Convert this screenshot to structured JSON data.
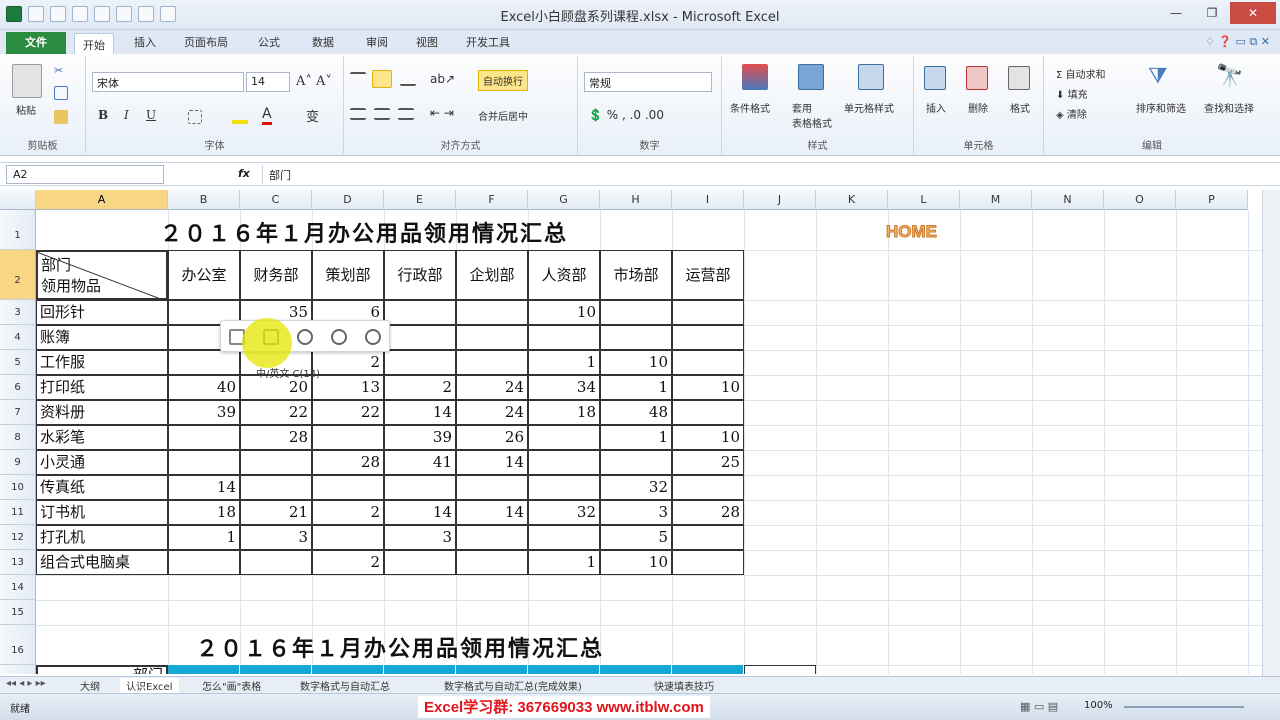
{
  "window": {
    "title": "Excel小白顾盘系列课程.xlsx - Microsoft Excel"
  },
  "tabs": {
    "file": "文件",
    "items": [
      "开始",
      "插入",
      "页面布局",
      "公式",
      "数据",
      "审阅",
      "视图",
      "开发工具"
    ]
  },
  "ribbon": {
    "font_name": "宋体",
    "font_size": "14",
    "number_format": "常规",
    "wrap_text": "自动换行",
    "merge_center": "合并后居中",
    "groups": {
      "clipboard": "剪贴板",
      "font": "字体",
      "align": "对齐方式",
      "number": "数字",
      "styles": "样式",
      "cells": "单元格",
      "edit": "编辑"
    },
    "buttons": {
      "paste": "粘贴",
      "cond": "条件格式",
      "table": "套用\n表格格式",
      "cellstyle": "单元格样式",
      "insert": "插入",
      "delete": "删除",
      "format": "格式",
      "autosum": "自动求和",
      "fill": "填充",
      "clear": "清除",
      "sort": "排序和筛选",
      "find": "查找和选择"
    }
  },
  "formula_bar": {
    "name_box": "A2",
    "fx": "fx",
    "content": "部门"
  },
  "columns": [
    "A",
    "B",
    "C",
    "D",
    "E",
    "F",
    "G",
    "H",
    "I",
    "J",
    "K",
    "L",
    "M",
    "N",
    "O",
    "P"
  ],
  "rows": [
    "1",
    "2",
    "3",
    "4",
    "5",
    "6",
    "7",
    "8",
    "9",
    "10",
    "11",
    "12",
    "13",
    "14",
    "15",
    "16",
    "17"
  ],
  "table1": {
    "title": "２０１６年１月办公用品领用情况汇总",
    "corner_top": "部门",
    "corner_bottom": "领用物品",
    "headers": [
      "办公室",
      "财务部",
      "策划部",
      "行政部",
      "企划部",
      "人资部",
      "市场部",
      "运营部"
    ],
    "rows": [
      {
        "item": "回形针",
        "vals": [
          "",
          "35",
          "6",
          "",
          "",
          "10",
          "",
          ""
        ]
      },
      {
        "item": "账簿",
        "vals": [
          "",
          "",
          "",
          "",
          "",
          "",
          "",
          ""
        ]
      },
      {
        "item": "工作服",
        "vals": [
          "",
          "",
          "2",
          "",
          "",
          "1",
          "10",
          ""
        ]
      },
      {
        "item": "打印纸",
        "vals": [
          "40",
          "20",
          "13",
          "2",
          "24",
          "34",
          "1",
          "10"
        ]
      },
      {
        "item": "资料册",
        "vals": [
          "39",
          "22",
          "22",
          "14",
          "24",
          "18",
          "48",
          ""
        ]
      },
      {
        "item": "水彩笔",
        "vals": [
          "",
          "28",
          "",
          "39",
          "26",
          "",
          "1",
          "10"
        ]
      },
      {
        "item": "小灵通",
        "vals": [
          "",
          "",
          "28",
          "41",
          "14",
          "",
          "",
          "25"
        ]
      },
      {
        "item": "传真纸",
        "vals": [
          "14",
          "",
          "",
          "",
          "",
          "",
          "32",
          ""
        ]
      },
      {
        "item": "订书机",
        "vals": [
          "18",
          "21",
          "2",
          "14",
          "14",
          "32",
          "3",
          "28"
        ]
      },
      {
        "item": "打孔机",
        "vals": [
          "1",
          "3",
          "",
          "3",
          "",
          "",
          "5",
          ""
        ]
      },
      {
        "item": "组合式电脑桌",
        "vals": [
          "",
          "",
          "2",
          "",
          "",
          "1",
          "10",
          ""
        ]
      }
    ]
  },
  "home_label": "HOME",
  "tooltip": "中/英文 C(14)",
  "table2": {
    "title": "２０１６年１月办公用品领用情况汇总",
    "corner": "部门"
  },
  "sheet_tabs": [
    "大纲",
    "认识Excel",
    "怎么\"画\"表格",
    "数字格式与自动汇总",
    "数字格式与自动汇总(完成效果)",
    "快速填表技巧"
  ],
  "status": {
    "ready": "就绪",
    "zoom": "100%"
  },
  "watermark": "Excel学习群: 367669033   www.itblw.com"
}
